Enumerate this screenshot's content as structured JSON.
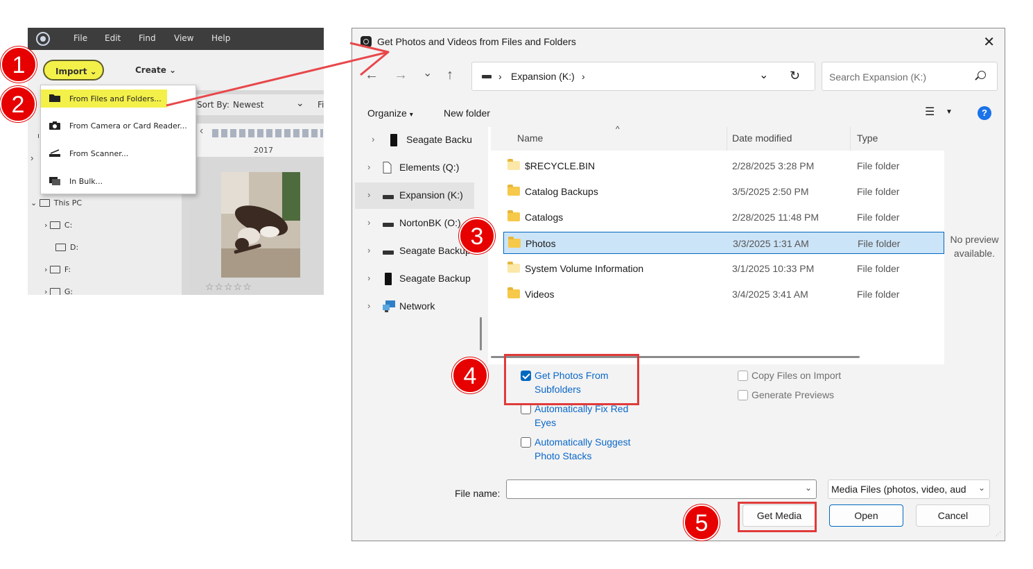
{
  "app": {
    "menu": [
      "File",
      "Edit",
      "Find",
      "View",
      "Help"
    ],
    "import_label": "Import",
    "create_label": "Create",
    "sort_by_label": "Sort By:",
    "sort_by_value": "Newest",
    "filter_cut": "Fi",
    "timeline_year": "2017",
    "stars": "☆☆☆☆☆",
    "import_menu": [
      {
        "label": "From Files and Folders...",
        "icon": "folder-icon"
      },
      {
        "label": "From Camera or Card Reader...",
        "icon": "camera-icon"
      },
      {
        "label": "From Scanner...",
        "icon": "scanner-icon"
      },
      {
        "label": "In Bulk...",
        "icon": "bulk-import-icon"
      }
    ],
    "tree": [
      {
        "label": "This PC"
      },
      {
        "label": "C:"
      },
      {
        "label": "D:"
      },
      {
        "label": "F:"
      },
      {
        "label": "G:"
      }
    ]
  },
  "callouts": [
    "1",
    "2",
    "3",
    "4",
    "5"
  ],
  "dialog": {
    "title": "Get Photos and Videos from Files and Folders",
    "close": "✕",
    "address": {
      "segment": "Expansion (K:)"
    },
    "search_placeholder": "Search Expansion (K:)",
    "organize_label": "Organize",
    "new_folder_label": "New folder",
    "help_label": "?",
    "nav_pane": [
      {
        "label": "Seagate Backu",
        "icon": "usb-drive-icon"
      },
      {
        "label": "Elements (Q:)",
        "icon": "document-icon"
      },
      {
        "label": "Expansion (K:)",
        "icon": "drive-icon"
      },
      {
        "label": "NortonBK (O:)",
        "icon": "drive-icon"
      },
      {
        "label": "Seagate Backup",
        "icon": "drive-icon"
      },
      {
        "label": "Seagate Backup",
        "icon": "usb-drive-icon"
      },
      {
        "label": "Network",
        "icon": "network-icon"
      }
    ],
    "columns": {
      "name": "Name",
      "date": "Date modified",
      "type": "Type"
    },
    "files": [
      {
        "name": "$RECYCLE.BIN",
        "date": "2/28/2025 3:28 PM",
        "type": "File folder"
      },
      {
        "name": "Catalog Backups",
        "date": "3/5/2025 2:50 PM",
        "type": "File folder"
      },
      {
        "name": "Catalogs",
        "date": "2/28/2025 11:48 PM",
        "type": "File folder"
      },
      {
        "name": "Photos",
        "date": "3/3/2025 1:31 AM",
        "type": "File folder"
      },
      {
        "name": "System Volume Information",
        "date": "3/1/2025 10:33 PM",
        "type": "File folder"
      },
      {
        "name": "Videos",
        "date": "3/4/2025 3:41 AM",
        "type": "File folder"
      }
    ],
    "preview_text": "No preview available.",
    "options": [
      {
        "label": "Get Photos From Subfolders",
        "checked": true
      },
      {
        "label": "Automatically Fix Red Eyes",
        "checked": false
      },
      {
        "label": "Automatically Suggest Photo Stacks",
        "checked": false
      },
      {
        "label": "Copy Files on Import",
        "checked": false
      },
      {
        "label": "Generate Previews",
        "checked": false
      }
    ],
    "file_name_label": "File name:",
    "file_name_value": "",
    "file_type_value": "Media Files (photos, video, aud",
    "get_media_label": "Get Media",
    "open_label": "Open",
    "cancel_label": "Cancel"
  },
  "colors": {
    "highlight_yellow": "#f3f04a",
    "callout_red": "#e60000",
    "selection_blue": "#cce4f7",
    "accent_blue": "#0067c0"
  }
}
